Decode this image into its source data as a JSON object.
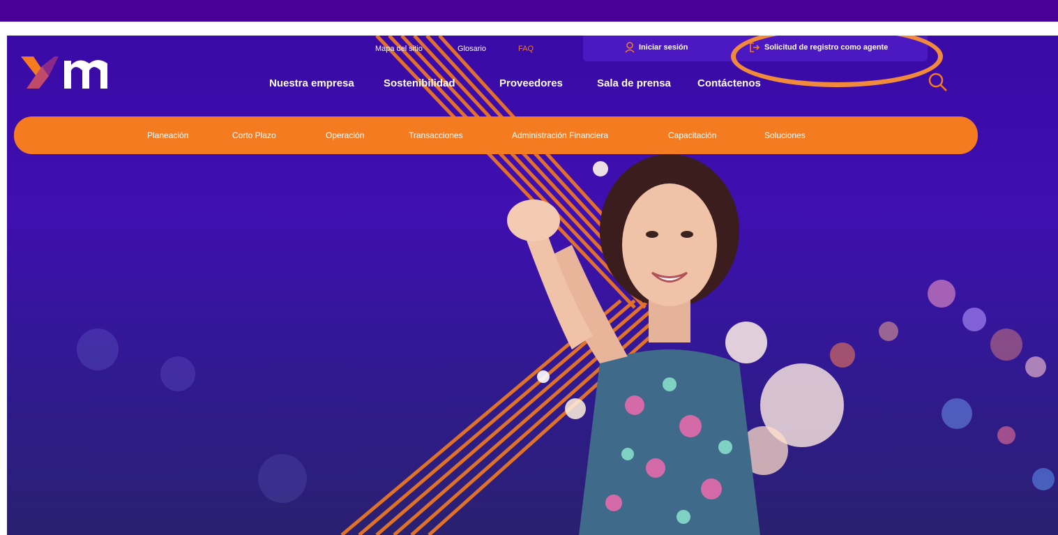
{
  "brand": {
    "logo_text": "xm",
    "accent": "#f47b20",
    "primary": "#4a0096"
  },
  "utility_links": [
    "Mapa del sitio",
    "Glosario",
    "FAQ"
  ],
  "account": {
    "login_label": "Iniciar sesión",
    "login_icon": "user-icon",
    "register_label": "Solicitud de registro como agente",
    "register_icon": "register-exit-icon"
  },
  "main_nav": [
    "Nuestra empresa",
    "Sostenibilidad",
    "Proveedores",
    "Sala de prensa",
    "Contáctenos"
  ],
  "search": {
    "icon": "search-icon"
  },
  "sub_nav": [
    "Planeación",
    "Corto Plazo",
    "Operación",
    "Transacciones",
    "Administración Financiera",
    "Capacitación",
    "Soluciones"
  ],
  "hero": {
    "description_visible": false
  }
}
